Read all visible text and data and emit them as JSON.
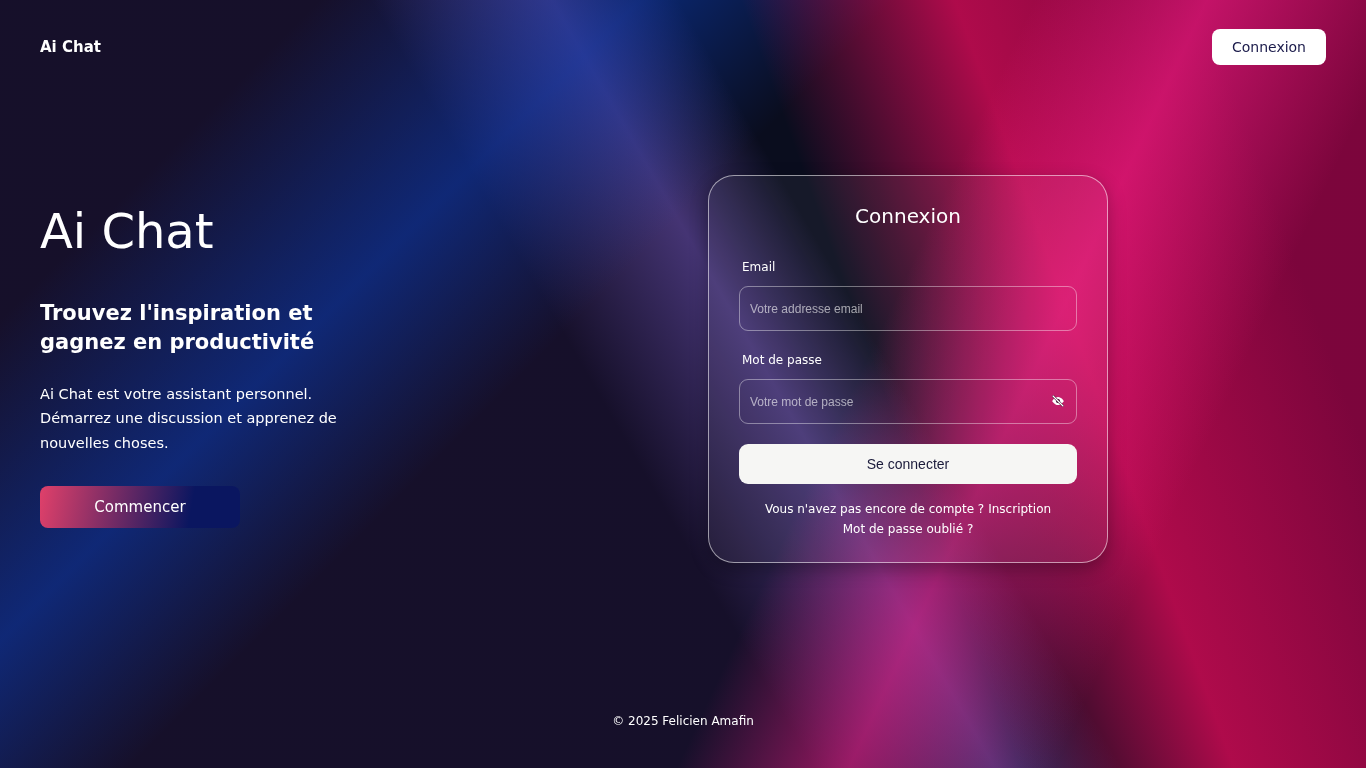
{
  "header": {
    "brand": "Ai Chat",
    "login_button": "Connexion"
  },
  "hero": {
    "title": "Ai Chat",
    "subtitle": "Trouvez l'inspiration et gagnez en productivité",
    "description": "Ai Chat est votre assistant personnel. Démarrez une discussion et apprenez de nouvelles choses.",
    "cta_button": "Commencer"
  },
  "login_form": {
    "title": "Connexion",
    "fields": [
      {
        "label": "Email",
        "placeholder": "Votre addresse email",
        "kind": "email"
      },
      {
        "label": "Mot de passe",
        "placeholder": "Votre mot de passe",
        "kind": "password"
      }
    ],
    "submit_button": "Se connecter",
    "signup_prompt": "Vous n'avez pas encore de compte ?",
    "signup_link": "Inscription",
    "forgot_link": "Mot de passe oublié ?"
  },
  "footer": {
    "copyright": "© 2025 Felicien Amafin"
  }
}
